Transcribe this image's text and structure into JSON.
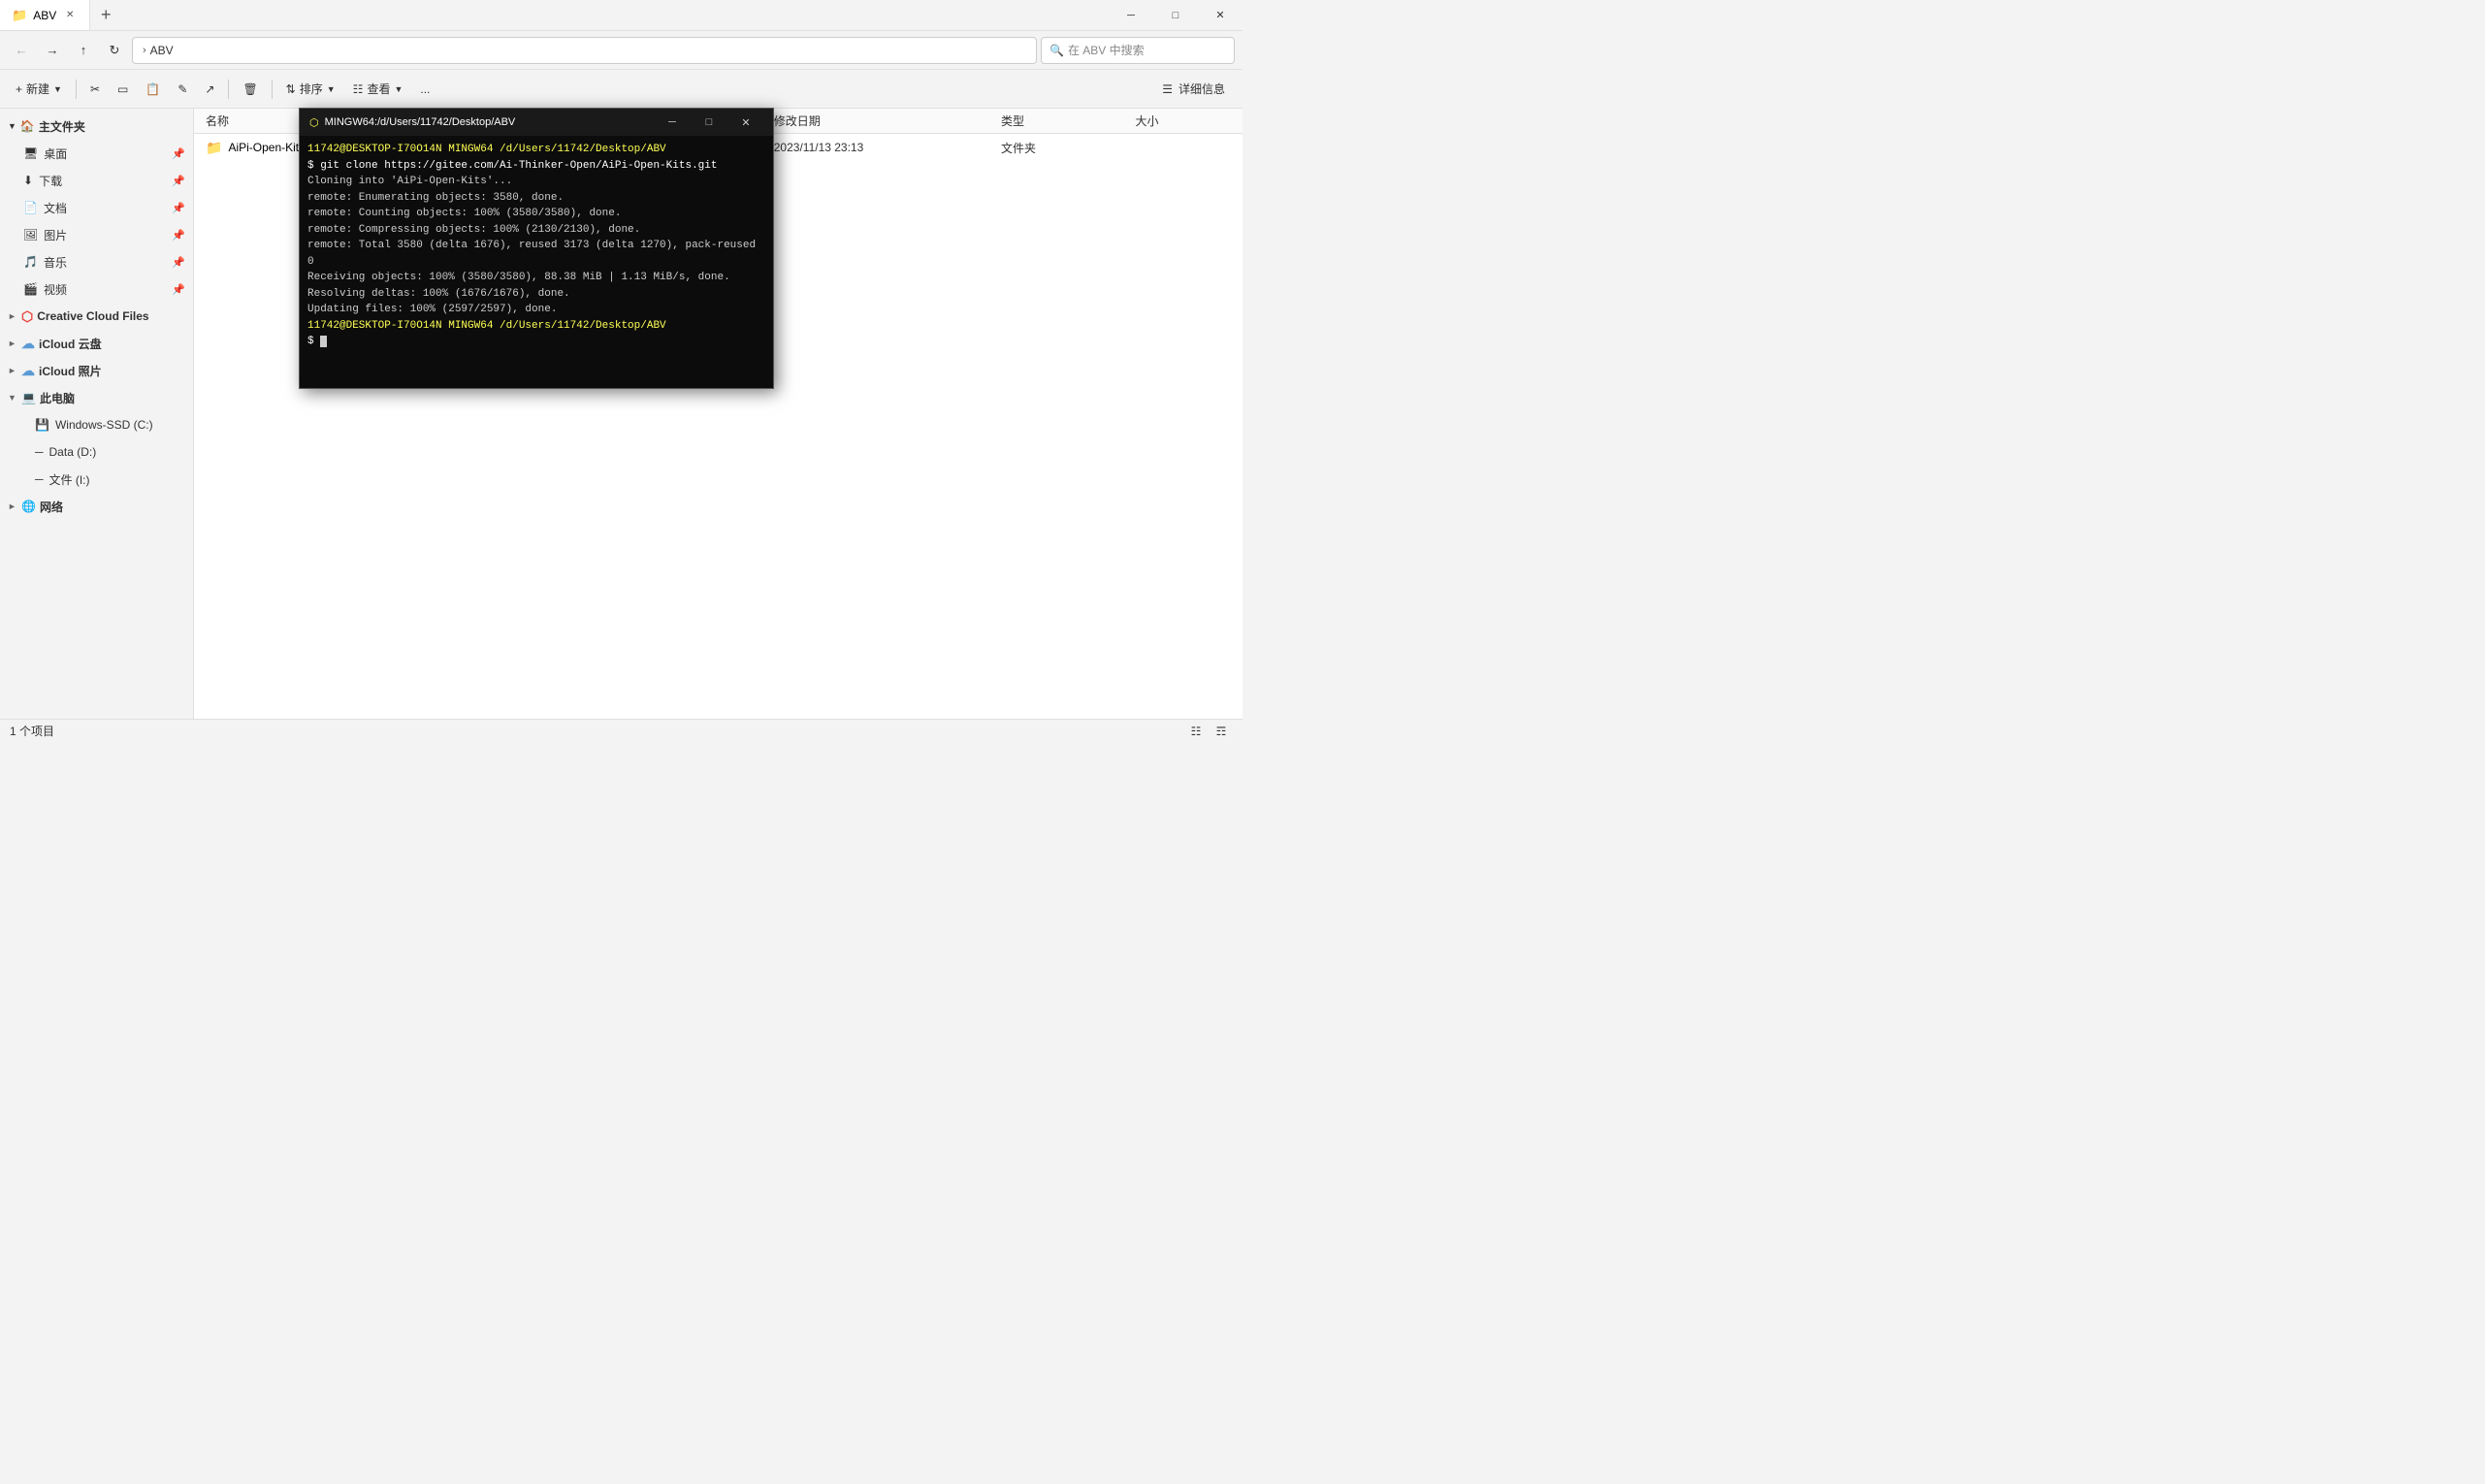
{
  "window": {
    "title": "ABV",
    "tab_label": "ABV"
  },
  "title_bar": {
    "tab_icon": "📁",
    "tab_close": "✕",
    "new_tab": "+",
    "minimize": "─",
    "maximize": "□",
    "close": "✕"
  },
  "toolbar": {
    "back_tooltip": "后退",
    "forward_tooltip": "前进",
    "up_tooltip": "向上",
    "refresh_tooltip": "刷新",
    "path_root": "ABV",
    "search_placeholder": "在 ABV 中搜索"
  },
  "action_toolbar": {
    "new_label": "新建",
    "cut_icon": "✂",
    "copy_icon": "⧉",
    "paste_icon": "📋",
    "rename_icon": "✎",
    "share_icon": "↗",
    "delete_icon": "🗑",
    "sort_label": "排序",
    "view_label": "查看",
    "more_label": "...",
    "details_label": "详细信息"
  },
  "sidebar": {
    "quick_access_label": "主文件夹",
    "items": [
      {
        "label": "桌面",
        "icon": "desktop",
        "pinned": true
      },
      {
        "label": "下载",
        "icon": "download",
        "pinned": true
      },
      {
        "label": "文档",
        "icon": "document",
        "pinned": true
      },
      {
        "label": "图片",
        "icon": "picture",
        "pinned": true
      },
      {
        "label": "音乐",
        "icon": "music",
        "pinned": true
      },
      {
        "label": "视频",
        "icon": "video",
        "pinned": true
      }
    ],
    "cloud_items": [
      {
        "label": "Creative Cloud Files",
        "icon": "cloud",
        "expandable": true
      },
      {
        "label": "iCloud 云盘",
        "icon": "cloud",
        "expandable": true
      },
      {
        "label": "iCloud 照片",
        "icon": "cloud",
        "expandable": true
      }
    ],
    "this_pc": {
      "label": "此电脑",
      "expanded": true,
      "drives": [
        {
          "label": "Windows-SSD (C:)",
          "icon": "drive"
        },
        {
          "label": "Data (D:)",
          "icon": "drive"
        },
        {
          "label": "文件 (I:)",
          "icon": "drive"
        }
      ]
    },
    "network_label": "网络"
  },
  "file_list": {
    "columns": {
      "name": "名称",
      "modified": "修改日期",
      "type": "类型",
      "size": "大小"
    },
    "files": [
      {
        "name": "AiPi-Open-Kits",
        "icon": "folder",
        "modified": "2023/11/13 23:13",
        "type": "文件夹",
        "size": ""
      }
    ]
  },
  "status_bar": {
    "count": "1 个项目"
  },
  "terminal": {
    "title": "MINGW64:/d/Users/11742/Desktop/ABV",
    "title_icon": "⬡",
    "line1_prompt": "11742@DESKTOP-I70O14N MINGW64 /d/Users/11742/Desktop/ABV",
    "line1_cmd": "$ git clone https://gitee.com/Ai-Thinker-Open/AiPi-Open-Kits.git",
    "line2": "Cloning into 'AiPi-Open-Kits'...",
    "line3": "remote: Enumerating objects: 3580, done.",
    "line4": "remote: Counting objects: 100% (3580/3580), done.",
    "line5": "remote: Compressing objects: 100% (2130/2130), done.",
    "line6": "remote: Total 3580 (delta 1676), reused 3173 (delta 1270), pack-reused 0",
    "line7": "Receiving objects: 100% (3580/3580), 88.38 MiB | 1.13 MiB/s, done.",
    "line8": "Resolving deltas: 100% (1676/1676), done.",
    "line9": "Updating files: 100% (2597/2597), done.",
    "line10_prompt": "11742@DESKTOP-I70O14N MINGW64 /d/Users/11742/Desktop/ABV",
    "line11_cmd": "$ "
  }
}
